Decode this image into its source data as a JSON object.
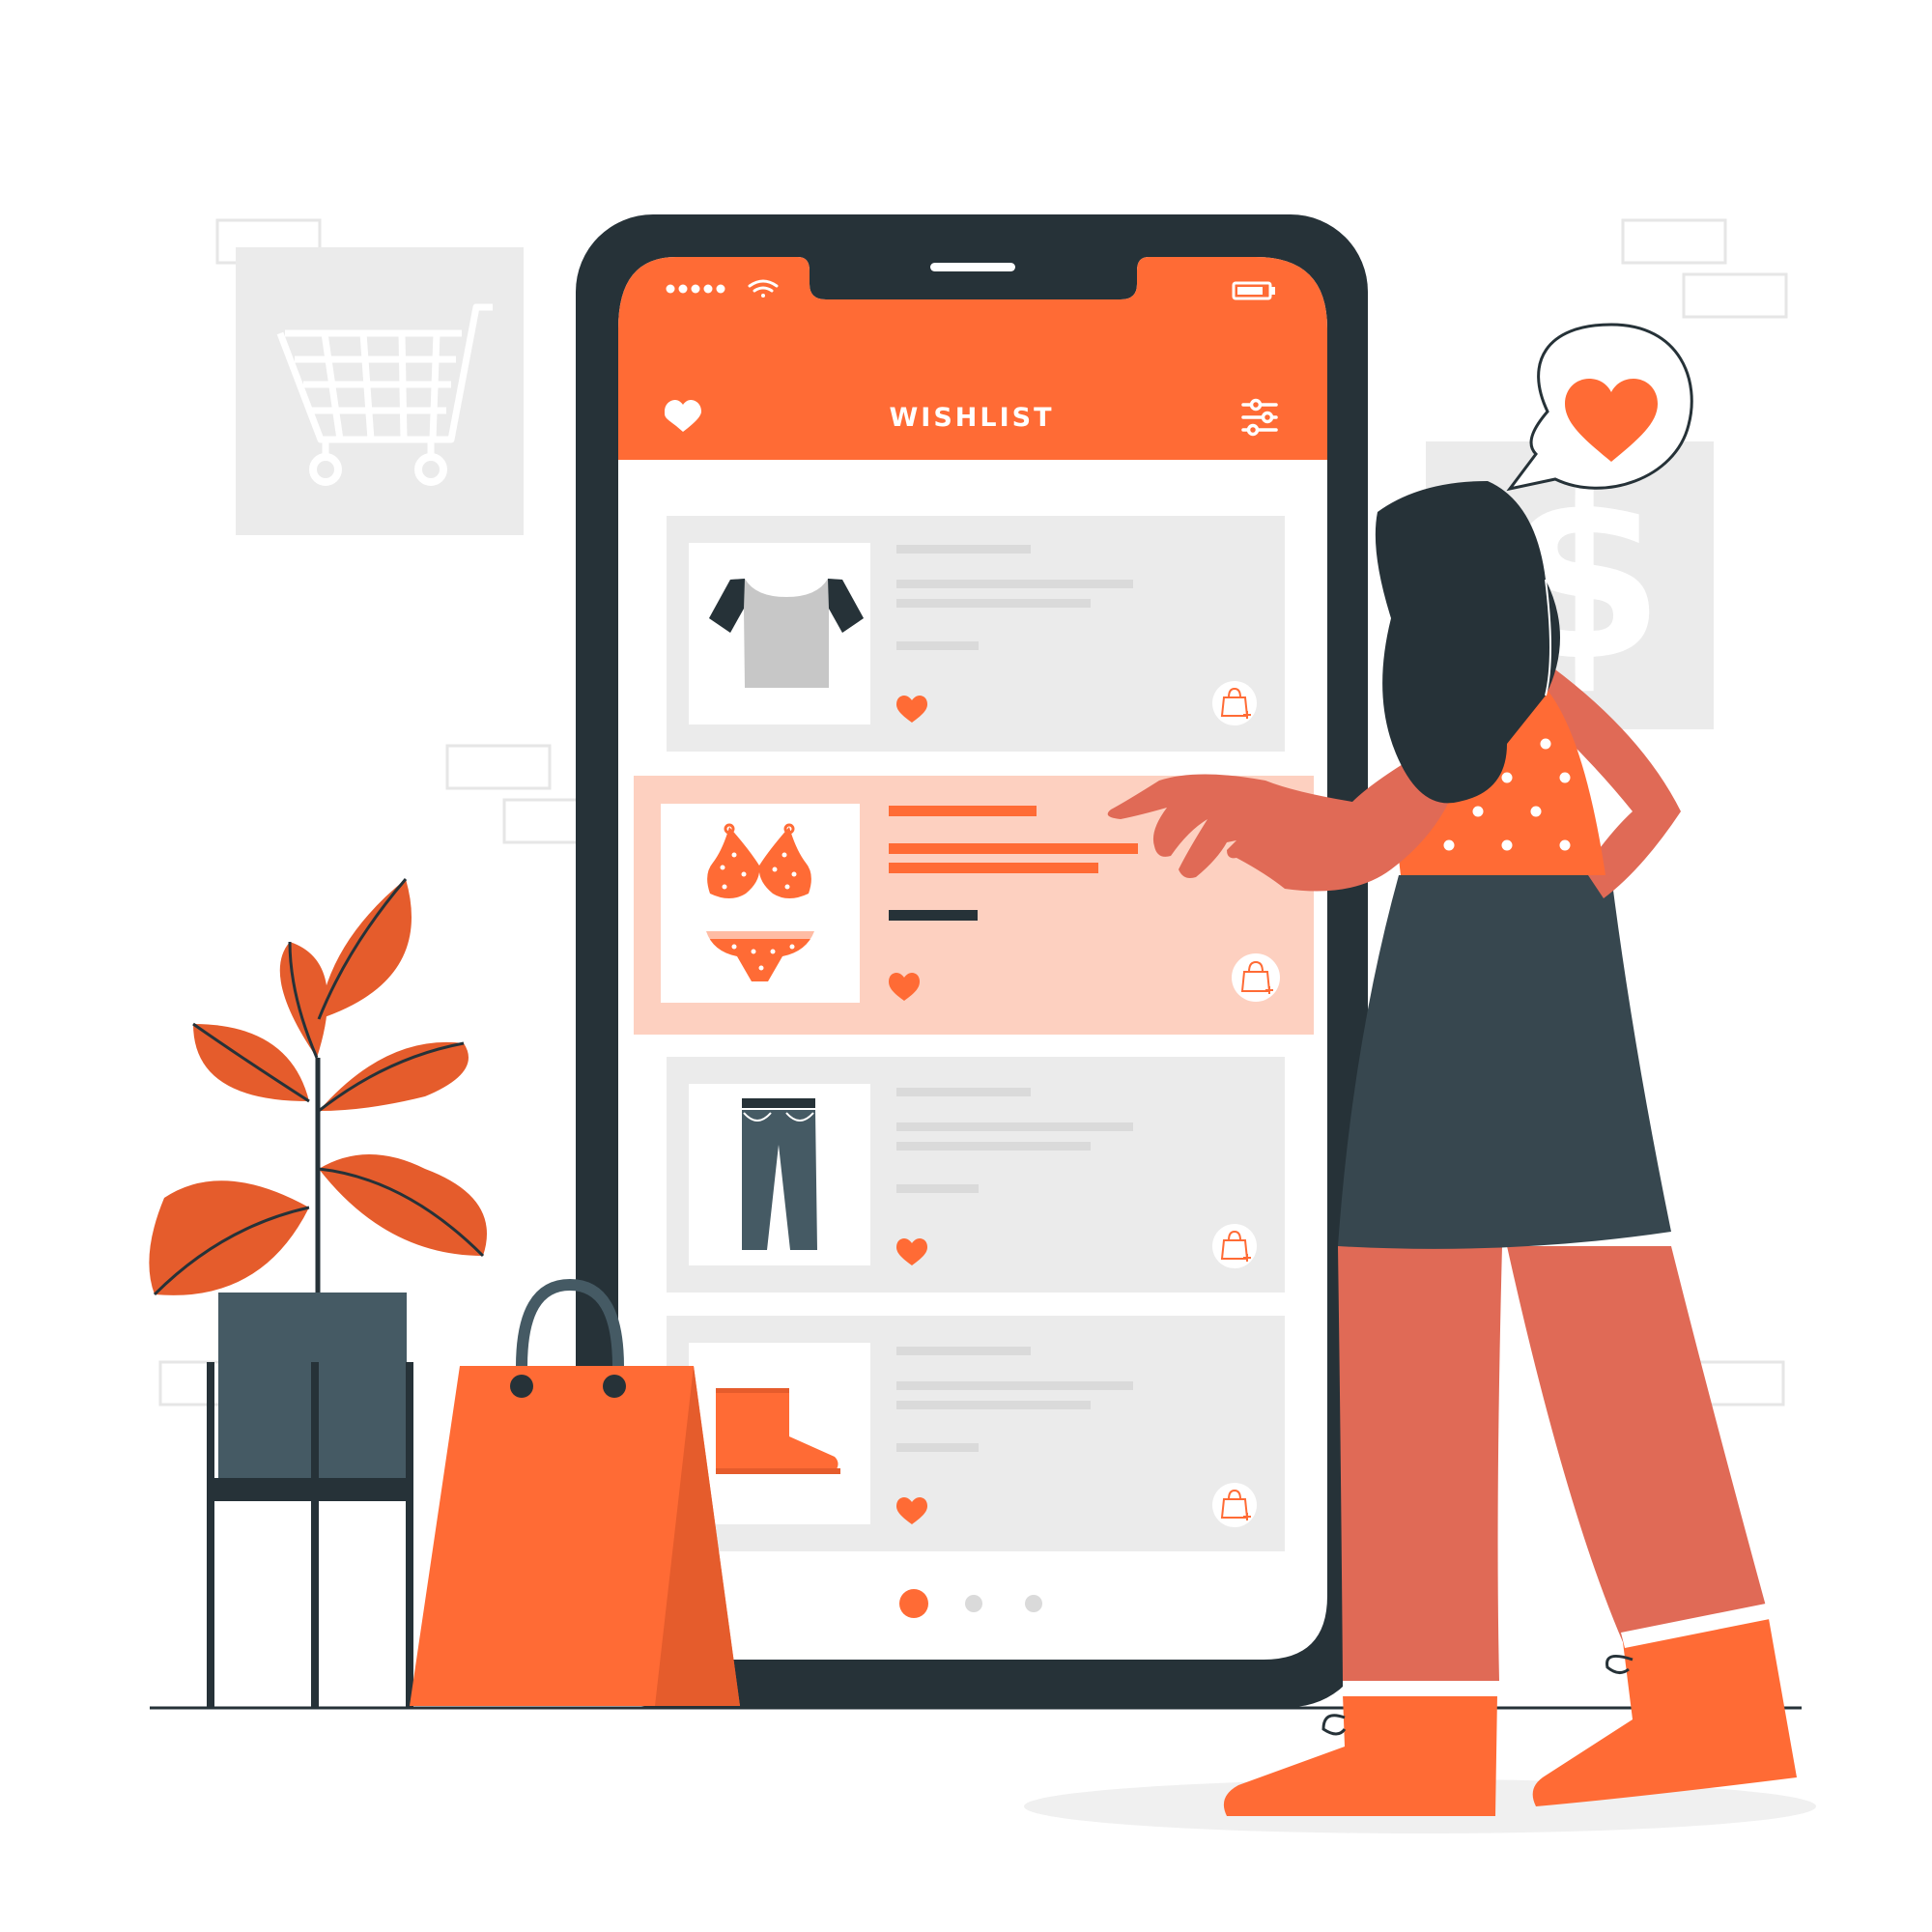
{
  "app": {
    "screen_title": "WISHLIST"
  },
  "colors": {
    "accent": "#ff6b35",
    "accent_dark": "#e55c2c",
    "skin": "#e06a56",
    "dark": "#263238",
    "slate": "#455a64",
    "card": "#ebebeb",
    "card_selected": "#fdd0c0",
    "panel": "#ebebeb"
  },
  "wishlist": {
    "items": [
      {
        "product": "t-shirt",
        "product_icon": "tshirt-icon",
        "selected": false
      },
      {
        "product": "bikini",
        "product_icon": "bikini-icon",
        "selected": true
      },
      {
        "product": "jeans",
        "product_icon": "jeans-icon",
        "selected": false
      },
      {
        "product": "boot",
        "product_icon": "boot-icon",
        "selected": false
      }
    ]
  },
  "pagination": {
    "pages": 3,
    "current": 1
  },
  "icons": {
    "header_left": "heart-icon",
    "header_right": "sliders-icon",
    "status_signal": "signal-dots-icon",
    "status_wifi": "wifi-icon",
    "status_battery": "battery-icon",
    "card_favorite": "heart-icon",
    "card_add_to_bag": "bag-plus-icon",
    "speech_bubble": "heart-icon",
    "background_panel_left": "shopping-cart-icon",
    "background_panel_right": "dollar-icon"
  }
}
